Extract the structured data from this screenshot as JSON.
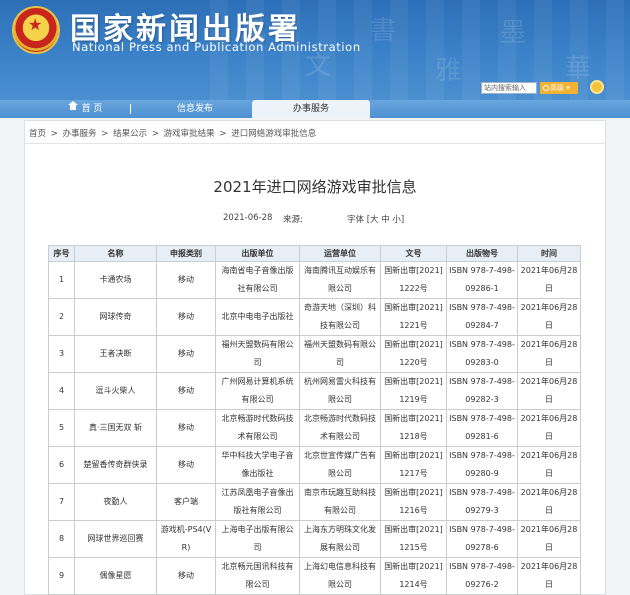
{
  "header": {
    "title": "国家新闻出版署",
    "subtitle": "National Press and Publication Administration",
    "search_placeholder": "站内搜索输入",
    "search_label": "高级"
  },
  "nav": {
    "items": [
      {
        "label": "首  页",
        "icon": "home-icon"
      },
      {
        "label": "信息发布"
      },
      {
        "label": "办事服务"
      }
    ]
  },
  "breadcrumb": [
    "首页",
    ">",
    "办事服务",
    ">",
    "结果公示",
    ">",
    "游戏审批结果",
    ">",
    "进口网络游戏审批信息"
  ],
  "article": {
    "title": "2021年进口网络游戏审批信息",
    "date": "2021-06-28",
    "source_label": "来源:",
    "font_size_label": "字体 [大 中 小]"
  },
  "table": {
    "headers": [
      "序号",
      "名称",
      "申报类别",
      "出版单位",
      "运营单位",
      "文号",
      "出版物号",
      "时间"
    ],
    "rows": [
      [
        "1",
        "卡通农场",
        "移动",
        "海南省电子音像出版社有限公司",
        "海南腾讯互动娱乐有限公司",
        "国新出审[2021]1222号",
        "ISBN 978-7-498-09286-1",
        "2021年06月28日"
      ],
      [
        "2",
        "网球传奇",
        "移动",
        "北京中电电子出版社",
        "奇游天地（深圳）科技有限公司",
        "国新出审[2021]1221号",
        "ISBN 978-7-498-09284-7",
        "2021年06月28日"
      ],
      [
        "3",
        "王者决断",
        "移动",
        "福州天盟数码有限公司",
        "福州天盟数码有限公司",
        "国新出审[2021]1220号",
        "ISBN 978-7-498-09283-0",
        "2021年06月28日"
      ],
      [
        "4",
        "逗斗火柴人",
        "移动",
        "广州网易计算机系统有限公司",
        "杭州网易雷火科技有限公司",
        "国新出审[2021]1219号",
        "ISBN 978-7-498-09282-3",
        "2021年06月28日"
      ],
      [
        "5",
        "真·三国无双 斩",
        "移动",
        "北京畅游时代数码技术有限公司",
        "北京畅游时代数码技术有限公司",
        "国新出审[2021]1218号",
        "ISBN 978-7-498-09281-6",
        "2021年06月28日"
      ],
      [
        "6",
        "楚留香传奇群侠录",
        "移动",
        "华中科技大学电子音像出版社",
        "北京世宣传媒广告有限公司",
        "国新出审[2021]1217号",
        "ISBN 978-7-498-09280-9",
        "2021年06月28日"
      ],
      [
        "7",
        "夜勤人",
        "客户端",
        "江苏凤凰电子音像出版社有限公司",
        "南京市玩趣互助科技有限公司",
        "国新出审[2021]1216号",
        "ISBN 978-7-498-09279-3",
        "2021年06月28日"
      ],
      [
        "8",
        "网球世界巡回赛",
        "游戏机-PS4(VR)",
        "上海电子出版有限公司",
        "上海东方明珠文化发展有限公司",
        "国新出审[2021]1215号",
        "ISBN 978-7-498-09278-6",
        "2021年06月28日"
      ],
      [
        "9",
        "偶像星愿",
        "移动",
        "北京畅元国讯科技有限公司",
        "上海幻电信息科技有限公司",
        "国新出审[2021]1214号",
        "ISBN 978-7-498-09276-2",
        "2021年06月28日"
      ]
    ]
  }
}
